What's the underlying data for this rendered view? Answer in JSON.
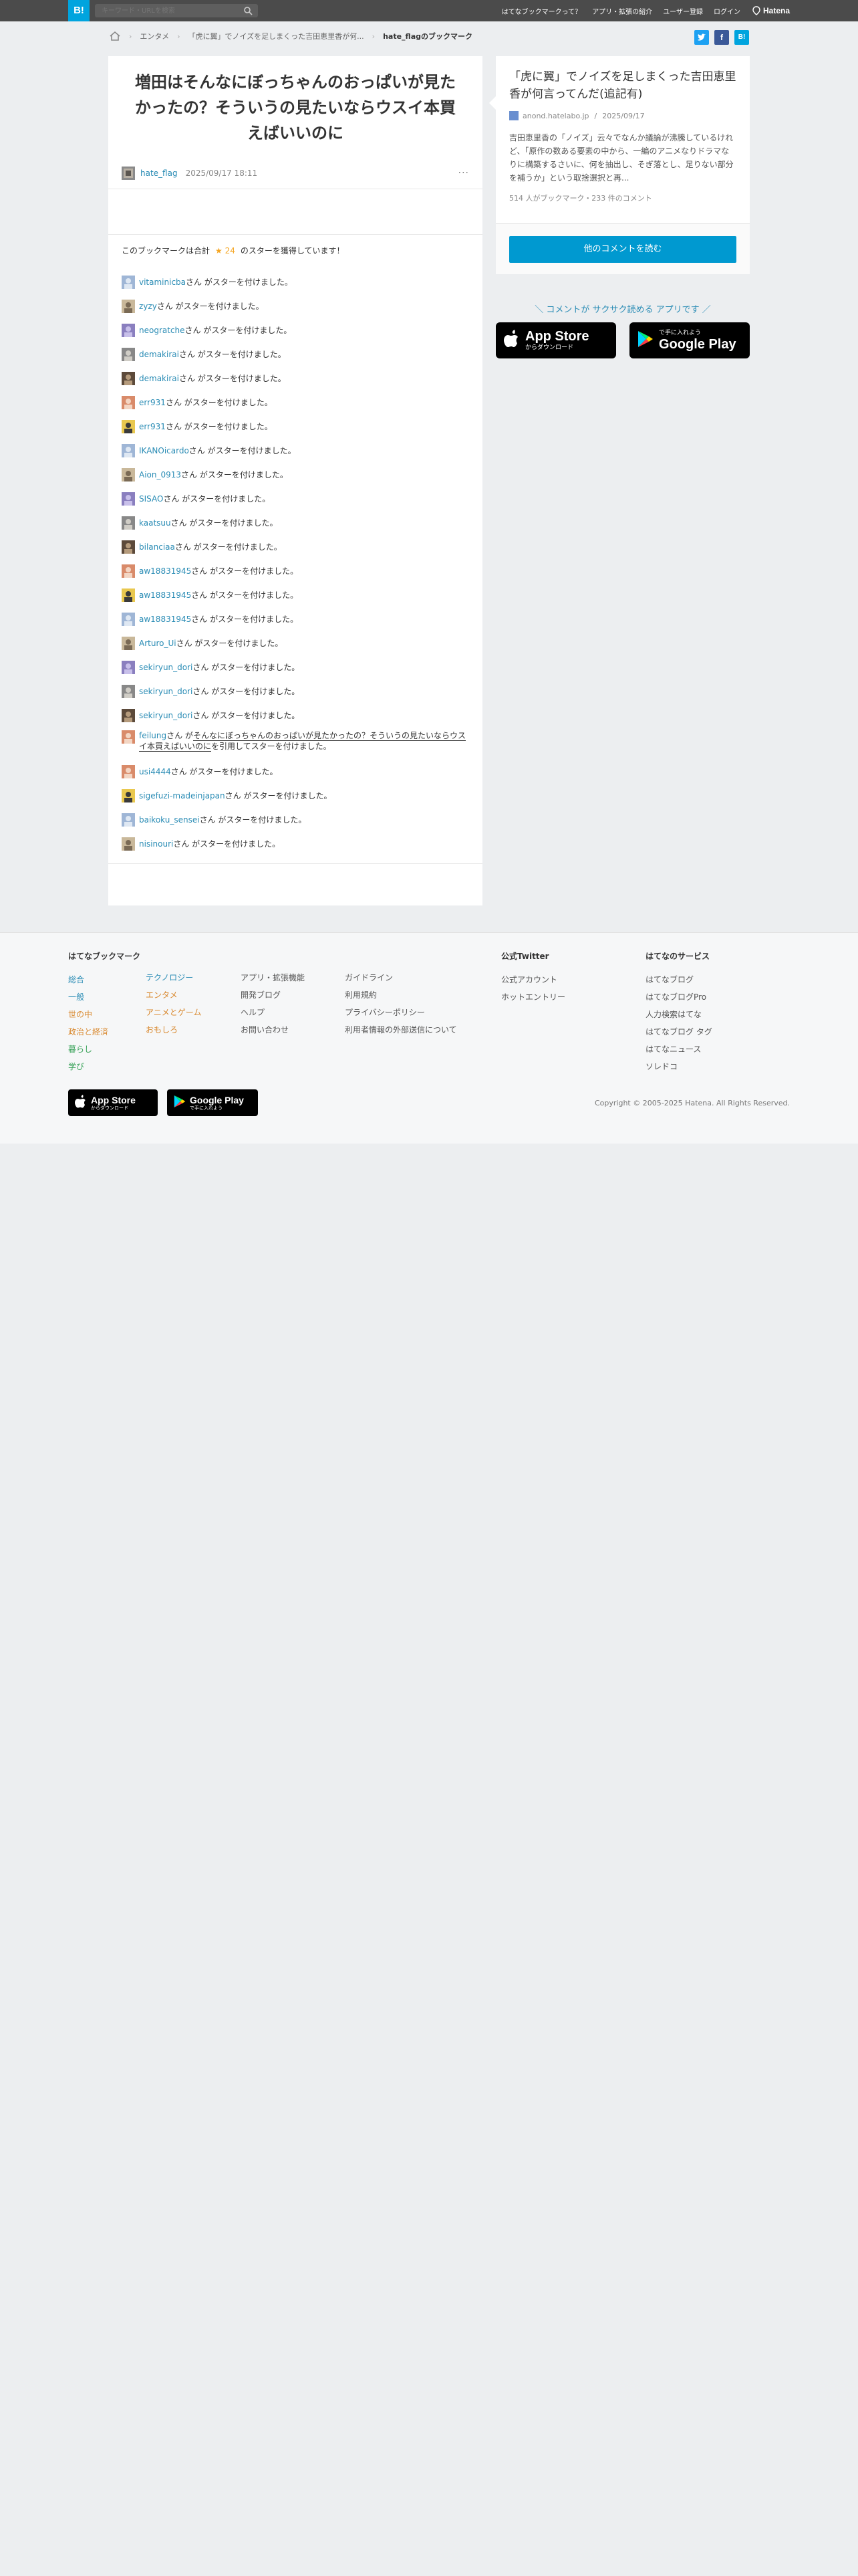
{
  "header": {
    "logo": "B!",
    "search_placeholder": "キーワード・URLを検索",
    "nav": [
      "はてなブックマークって？",
      "アプリ・拡張の紹介",
      "ユーザー登録",
      "ログイン"
    ],
    "brand": "Hatena"
  },
  "breadcrumb": {
    "items": [
      "エンタメ",
      "「虎に翼」でノイズを足しまくった吉田恵里香が何..."
    ],
    "current": "hate_flagのブックマーク"
  },
  "share": {
    "twitter": "t",
    "facebook": "f",
    "hatebu": "B!"
  },
  "bookmark": {
    "comment": "増田はそんなにぼっちゃんのおっぱいが見たかったの？そういうの見たいならウスイ本買えばいいのに",
    "user": "hate_flag",
    "date": "2025/09/17 18:11",
    "more": "···"
  },
  "stars": {
    "summary_before": "このブックマークは合計",
    "star_glyph": "★",
    "count": "24",
    "summary_after": "のスターを獲得しています！",
    "items": [
      {
        "user": "vitaminicba",
        "suffix": "さん がスターを付けました。"
      },
      {
        "user": "zyzy",
        "suffix": "さん がスターを付けました。"
      },
      {
        "user": "neogratche",
        "suffix": "さん がスターを付けました。"
      },
      {
        "user": "demakirai",
        "suffix": "さん がスターを付けました。"
      },
      {
        "user": "demakirai",
        "suffix": "さん がスターを付けました。"
      },
      {
        "user": "err931",
        "suffix": "さん がスターを付けました。"
      },
      {
        "user": "err931",
        "suffix": "さん がスターを付けました。"
      },
      {
        "user": "IKANOicardo",
        "suffix": "さん がスターを付けました。"
      },
      {
        "user": "Aion_0913",
        "suffix": "さん がスターを付けました。"
      },
      {
        "user": "SISAO",
        "suffix": "さん がスターを付けました。"
      },
      {
        "user": "kaatsuu",
        "suffix": "さん がスターを付けました。"
      },
      {
        "user": "bilanciaa",
        "suffix": "さん がスターを付けました。"
      },
      {
        "user": "aw18831945",
        "suffix": "さん がスターを付けました。"
      },
      {
        "user": "aw18831945",
        "suffix": "さん がスターを付けました。"
      },
      {
        "user": "aw18831945",
        "suffix": "さん がスターを付けました。"
      },
      {
        "user": "Arturo_Ui",
        "suffix": "さん がスターを付けました。"
      },
      {
        "user": "sekiryun_dori",
        "suffix": "さん がスターを付けました。"
      },
      {
        "user": "sekiryun_dori",
        "suffix": "さん がスターを付けました。"
      },
      {
        "user": "sekiryun_dori",
        "suffix": "さん がスターを付けました。"
      }
    ],
    "quoted": {
      "user": "feilung",
      "mid": "さん が",
      "quote": "そんなにぼっちゃんのおっぱいが見たかったの？そういうの見たいならウスイ本買えばいいのに",
      "suffix": "を引用してスターを付けました。"
    },
    "items_after": [
      {
        "user": "usi4444",
        "suffix": "さん がスターを付けました。"
      },
      {
        "user": "sigefuzi-madeinjapan",
        "suffix": "さん がスターを付けました。"
      },
      {
        "user": "baikoku_sensei",
        "suffix": "さん がスターを付けました。"
      },
      {
        "user": "nisinouri",
        "suffix": "さん がスターを付けました。"
      }
    ]
  },
  "entry": {
    "title": "「虎に翼」でノイズを足しまくった吉田恵里香が何言ってんだ(追記有)",
    "site": "anond.hatelabo.jp",
    "date": "2025/09/17",
    "summary": "吉田恵里香の「ノイズ」云々でなんか議論が沸騰しているけれど、「原作の数ある要素の中から、一編のアニメなりドラマなりに構築するさいに、何を抽出し、そぎ落とし、足りない部分を補うか」という取捨選択と再...",
    "counts": "514 人がブックマーク・233 件のコメント",
    "read_comments": "他のコメントを読む"
  },
  "app_promo": {
    "text": "＼ コメントが サクサク読める アプリです ／",
    "appstore_big": "App Store",
    "appstore_small": "からダウンロード",
    "googleplay_big": "Google Play",
    "googleplay_small": "で手に入れよう"
  },
  "footer": {
    "heading": "はてなブックマーク",
    "cat1": [
      "総合",
      "一般",
      "世の中",
      "政治と経済",
      "暮らし",
      "学び"
    ],
    "cat2": [
      "テクノロジー",
      "エンタメ",
      "アニメとゲーム",
      "おもしろ"
    ],
    "col3": [
      "アプリ・拡張機能",
      "開発ブログ",
      "ヘルプ",
      "お問い合わせ"
    ],
    "col4": [
      "ガイドライン",
      "利用規約",
      "プライバシーポリシー",
      "利用者情報の外部送信について"
    ],
    "twitter_heading": "公式Twitter",
    "twitter": [
      "公式アカウント",
      "ホットエントリー"
    ],
    "services_heading": "はてなのサービス",
    "services": [
      "はてなブログ",
      "はてなブログPro",
      "人力検索はてな",
      "はてなブログ タグ",
      "はてなニュース",
      "ソレドコ"
    ],
    "copyright": "Copyright © 2005-2025 Hatena. All Rights Reserved."
  },
  "colors": {
    "accent": "#00a4de",
    "link": "#2a8cb5",
    "star": "#f5a623",
    "header_bg": "#4b4b4b",
    "twitter": "#1da1f2",
    "facebook": "#3b5998",
    "cat_blue": "#2a8cb5",
    "cat_orange": "#d9892f"
  }
}
